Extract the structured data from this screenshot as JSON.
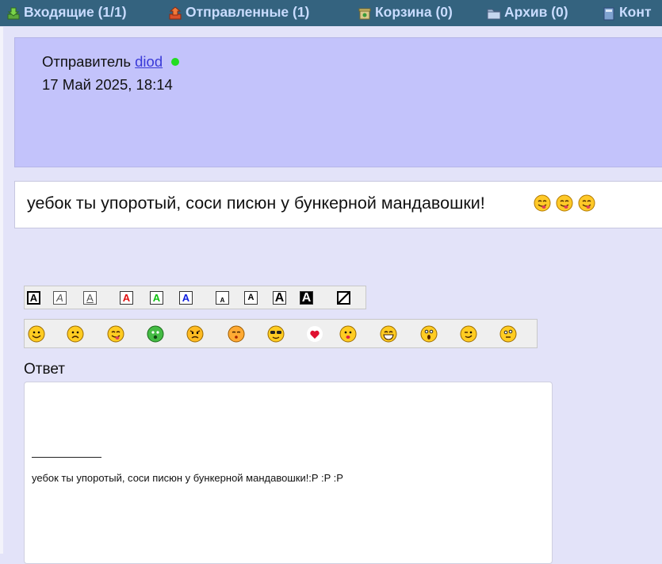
{
  "nav": {
    "inbox": "Входящие (1/1)",
    "sent": "Отправленные (1)",
    "trash": "Корзина (0)",
    "archive": "Архив (0)",
    "contacts": "Конт"
  },
  "message": {
    "sender_prefix": "Отправитель",
    "sender_name": "diod",
    "date": "17 Май 2025, 18:14",
    "text": "уебок ты упоротый, соси писюн у бункерной мандавошки!",
    "smileys": [
      "tongue-smiley-icon",
      "tongue-smiley-icon",
      "tongue-smiley-icon"
    ]
  },
  "format_toolbar": {
    "buttons": [
      "bold",
      "italic",
      "underline",
      "red",
      "green",
      "blue",
      "small",
      "normal",
      "large",
      "larger",
      "strike"
    ],
    "glyph": "A"
  },
  "smiley_toolbar": {
    "icons": [
      "smile",
      "sad",
      "tongue",
      "green-alien",
      "angry",
      "blush",
      "cool",
      "heart",
      "kiss",
      "grin",
      "shocked",
      "wink",
      "thinking"
    ]
  },
  "reply": {
    "label": "Ответ",
    "quote": "уебок ты упоротый, соси писюн у бункерной мандавошки!:P :P :P"
  },
  "colors": {
    "nav_bg": "#34637f",
    "nav_text": "#c9dcff",
    "header_bg": "#c3c3fb",
    "page_bg": "#e3e3f9",
    "link": "#3a3ad8",
    "online": "#22dd22"
  }
}
